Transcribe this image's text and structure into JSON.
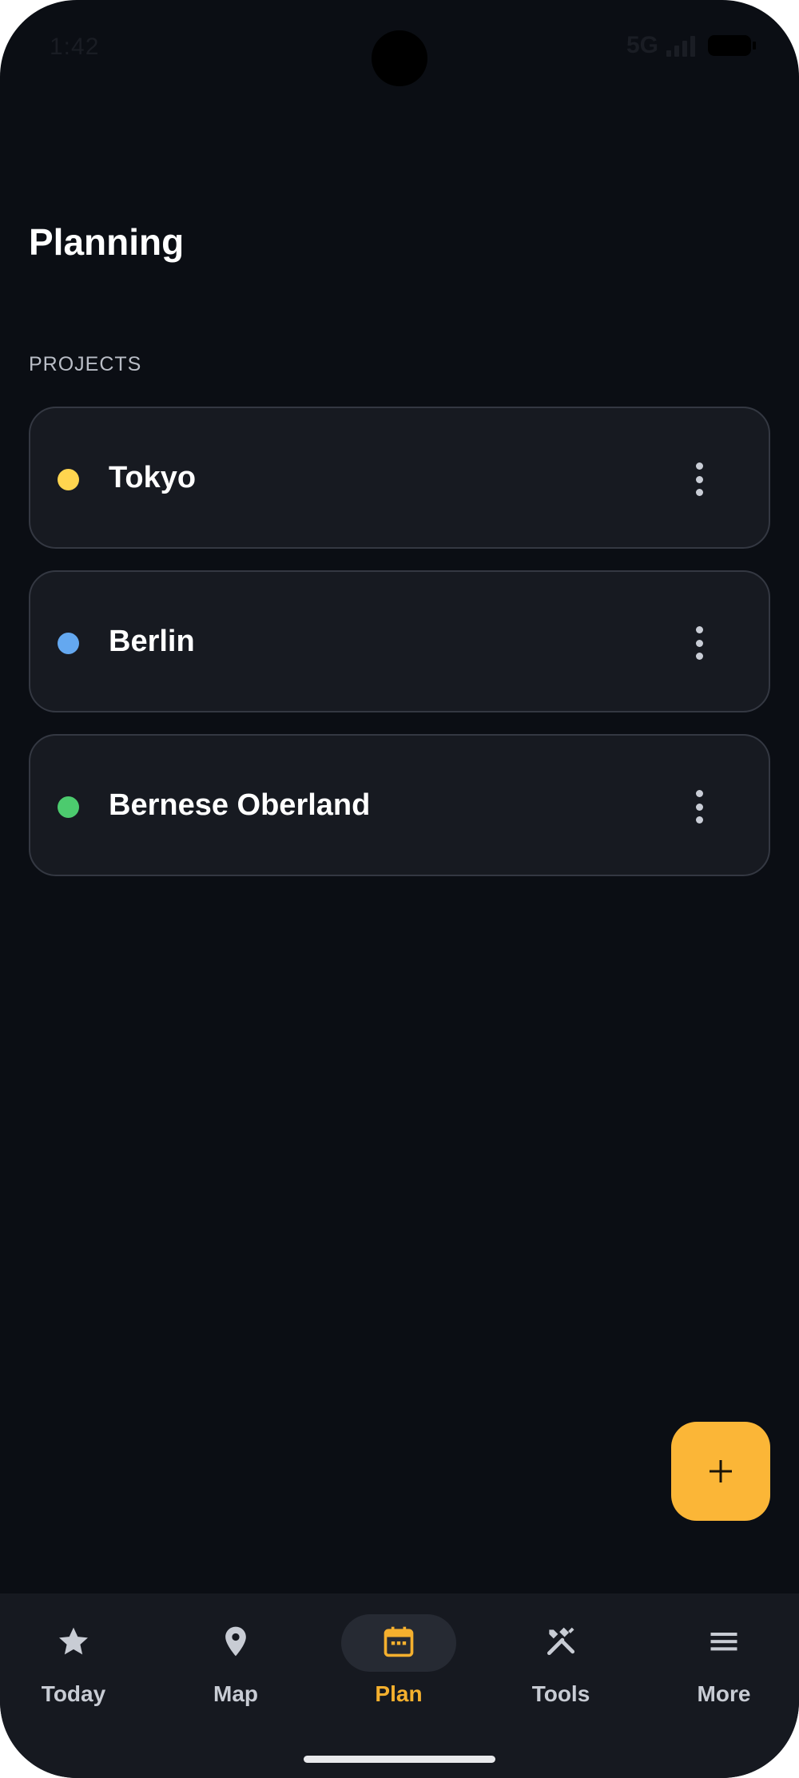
{
  "status_bar": {
    "time": "1:42",
    "network": "5G"
  },
  "header": {
    "title": "Planning"
  },
  "projects": {
    "section_label": "PROJECTS",
    "items": [
      {
        "name": "Tokyo",
        "color": "#FFD54F"
      },
      {
        "name": "Berlin",
        "color": "#64A8F0"
      },
      {
        "name": "Bernese Oberland",
        "color": "#4CCB6E"
      }
    ]
  },
  "fab": {
    "icon": "plus-icon"
  },
  "bottom_nav": {
    "items": [
      {
        "label": "Today",
        "icon": "star-icon",
        "active": false
      },
      {
        "label": "Map",
        "icon": "location-pin-icon",
        "active": false
      },
      {
        "label": "Plan",
        "icon": "calendar-icon",
        "active": true
      },
      {
        "label": "Tools",
        "icon": "tools-icon",
        "active": false
      },
      {
        "label": "More",
        "icon": "menu-icon",
        "active": false
      }
    ]
  },
  "colors": {
    "background": "#0B0E14",
    "card": "#171A21",
    "accent": "#FBB637"
  }
}
